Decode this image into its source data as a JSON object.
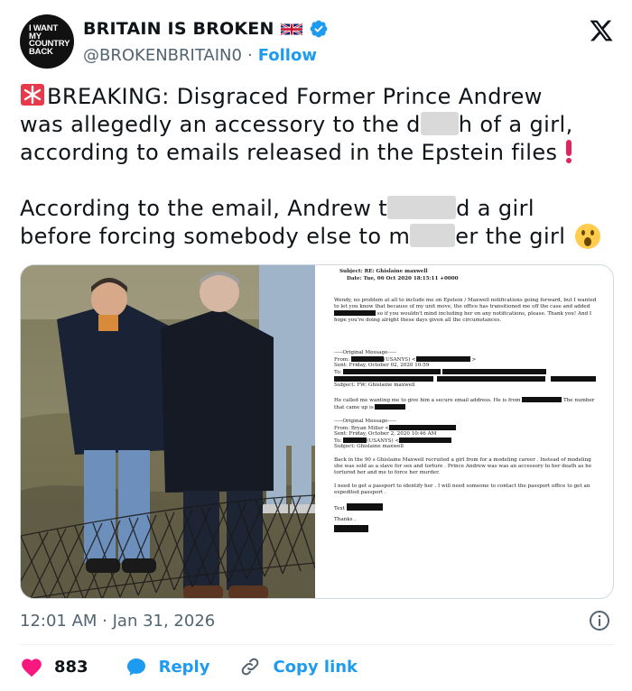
{
  "account": {
    "avatar_text": "I WANT MY COUNTRY BACK",
    "display_name": "BRITAIN IS BROKEN",
    "handle": "@BROKENBRITAIN0",
    "separator": "·",
    "follow_label": "Follow"
  },
  "tweet": {
    "line1": "BREAKING: Disgraced Former Prince Andrew",
    "line2a": "was allegedly an accessory to the d",
    "line2b": "h of a girl,",
    "line3": "according to emails released in the Epstein files",
    "line4a": "According to the email, Andrew t",
    "line4b": "d a girl",
    "line5a": "before forcing somebody else to m",
    "line5b": "er the girl"
  },
  "document": {
    "subject": "Subject: RE: Ghislaine maxwell",
    "date": "Date: Tue, 06 Oct 2020 18:15:11 +0000",
    "body1": "Wendy, no problem at all to include me on Epstein / Maxwell notifications going forward, but I wanted to let you know that because of my unit move, the office has transitioned me off the case and added",
    "body1b": "so if you wouldn't mind including her on any notifications, please. Thank you! And I hope you're doing alright these days given all the circumstances.",
    "orig1": "-----Original Message-----",
    "from1": "From:",
    "from1b": "(USANYS) <",
    "sent1": "Sent: Friday, October 02, 2020 10:59",
    "to1": "To:",
    "subj1": "Subject: FW: Ghislaine maxwell",
    "called": "He called me wanting me to give him a secure email address. He is from",
    "called_b": "The number that came up is",
    "orig2": "-----Original Message-----",
    "from2": "From: Bryan Miller <",
    "sent2": "Sent: Friday, October 2, 2020 10:46 AM",
    "to2": "To:",
    "to2b": "(USANYS) <",
    "subj2": "Subject: Ghislaine maxwell",
    "body2": "Back in the 90 s Ghislaine Maxwell recruited a girl from for a modeling career . Instead of modeling she was sold as a slave for sex and torture . Prince Andrew was was an accessory to her death as he tortured her and me to force her murder.",
    "body3": "I need to get a passport to identify her . I will need someone to contact the passport office to get an expedited passport .",
    "text": "Text",
    "thanks": "Thanks ."
  },
  "meta": {
    "timestamp": "12:01 AM · Jan 31, 2026"
  },
  "actions": {
    "likes": "883",
    "reply": "Reply",
    "copy_link": "Copy link"
  },
  "colors": {
    "accent": "#1d9bf0",
    "like": "#f91880",
    "muted": "#536471",
    "text": "#0f1419"
  },
  "icons": [
    "x-logo-icon",
    "verified-badge-icon",
    "uk-flag-icon",
    "siren-icon",
    "exclamation-icon",
    "astonished-face-icon",
    "info-icon",
    "heart-icon",
    "reply-bubble-icon",
    "link-icon"
  ]
}
